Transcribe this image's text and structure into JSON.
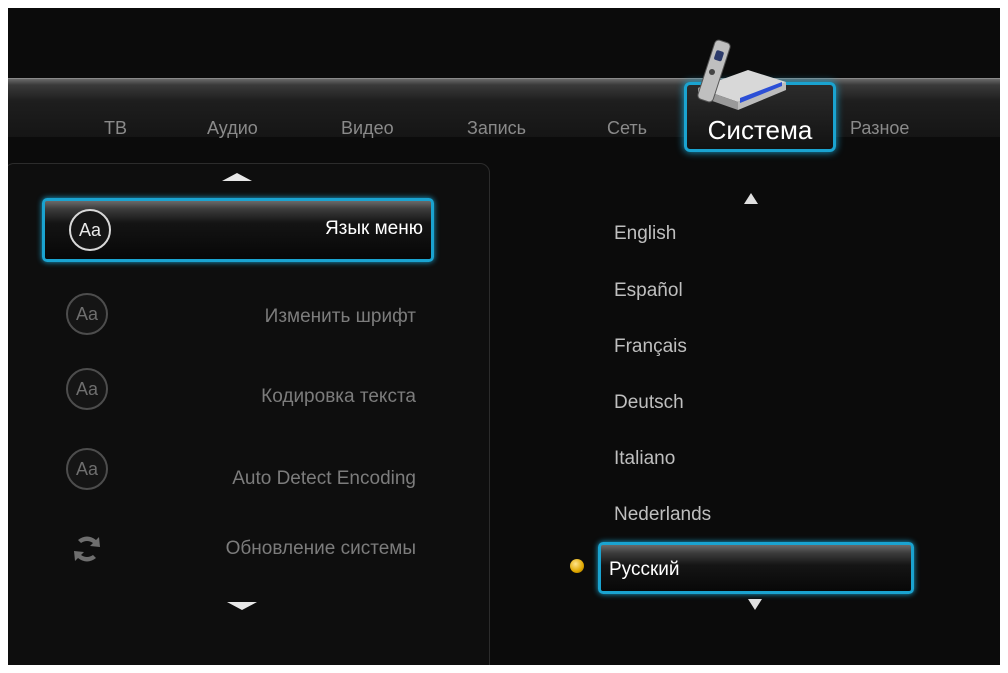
{
  "tabs": [
    {
      "label": "ТВ"
    },
    {
      "label": "Аудио"
    },
    {
      "label": "Видео"
    },
    {
      "label": "Запись"
    },
    {
      "label": "Сеть"
    },
    {
      "label": "Система",
      "active": true
    },
    {
      "label": "Разное"
    }
  ],
  "menu": {
    "items": [
      {
        "label": "Язык меню",
        "icon": "aa-icon",
        "selected": true
      },
      {
        "label": "Изменить шрифт",
        "icon": "aa-icon"
      },
      {
        "label": "Кодировка текста",
        "icon": "aa-icon"
      },
      {
        "label": "Auto Detect Encoding",
        "icon": "aa-icon"
      },
      {
        "label": "Обновление системы",
        "icon": "refresh-icon"
      }
    ]
  },
  "aa_text": "Aa",
  "languages": {
    "items": [
      "English",
      "Español",
      "Français",
      "Deutsch",
      "Italiano",
      "Nederlands",
      "Русский"
    ],
    "selected": "Русский"
  },
  "colors": {
    "accent": "#1aa3d0",
    "background": "#0b0b0b",
    "dot": "#e0a800"
  }
}
